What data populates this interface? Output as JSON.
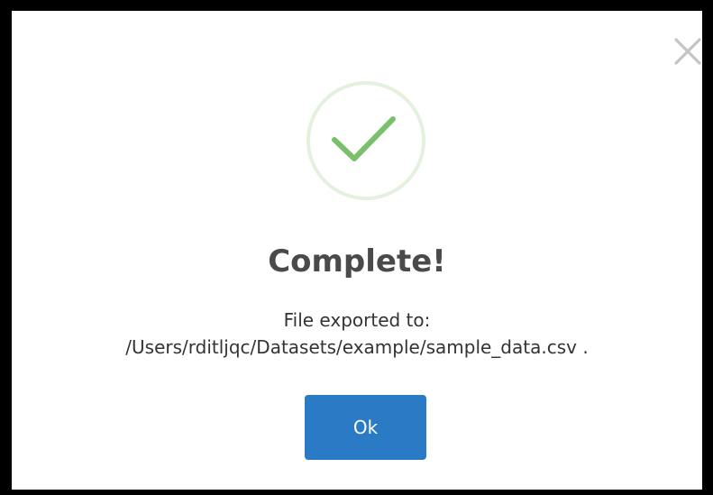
{
  "dialog": {
    "title": "Complete!",
    "message_line1": "File exported to:",
    "message_line2": "/Users/rditljqc/Datasets/example/sample_data.csv .",
    "ok_label": "Ok",
    "close_icon": "close-icon",
    "status_icon": "check-circle-icon"
  },
  "colors": {
    "accent": "#2a7ac5",
    "success": "#7ac06a",
    "success_ring": "#e3f1de",
    "close": "#c4c4c4",
    "title": "#4a4a4a"
  }
}
